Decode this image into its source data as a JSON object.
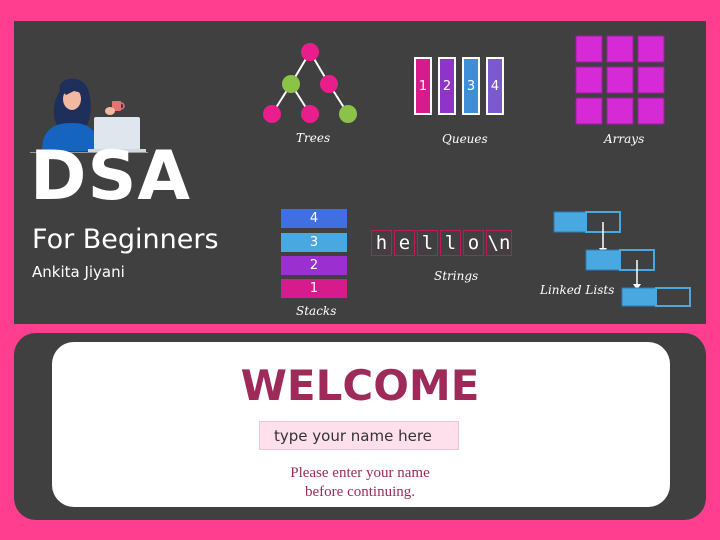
{
  "title": {
    "main": "DSA",
    "subtitle": "For Beginners",
    "author": "Ankita Jiyani"
  },
  "topics": {
    "trees": "Trees",
    "queues": "Queues",
    "arrays": "Arrays",
    "stacks": "Stacks",
    "strings": "Strings",
    "linked_lists": "Linked Lists"
  },
  "queue_items": [
    "1",
    "2",
    "3",
    "4"
  ],
  "stack_items": [
    "4",
    "3",
    "2",
    "1"
  ],
  "string_chars": [
    "h",
    "e",
    "l",
    "l",
    "o",
    "\\n"
  ],
  "welcome": {
    "heading": "WELCOME",
    "input_placeholder": "type your name here",
    "message_line1": "Please enter your name",
    "message_line2": "before continuing."
  },
  "colors": {
    "background": "#ff3e8f",
    "panel": "#404040",
    "accent_text": "#9e2a5a",
    "node_pink": "#e91e8c",
    "node_green": "#8bc34a",
    "array_magenta": "#d62ad6",
    "stack_blue": "#3f6fe0",
    "stack_cyan": "#4aa8e0",
    "stack_purple": "#9b2fd0",
    "stack_pink": "#d81b8c",
    "queue_pink": "#d81b8c",
    "queue_purple": "#8e35c9",
    "queue_blue": "#3f8fd8",
    "queue_violet": "#7b5ad0",
    "linked_blue": "#4aa8e0"
  }
}
